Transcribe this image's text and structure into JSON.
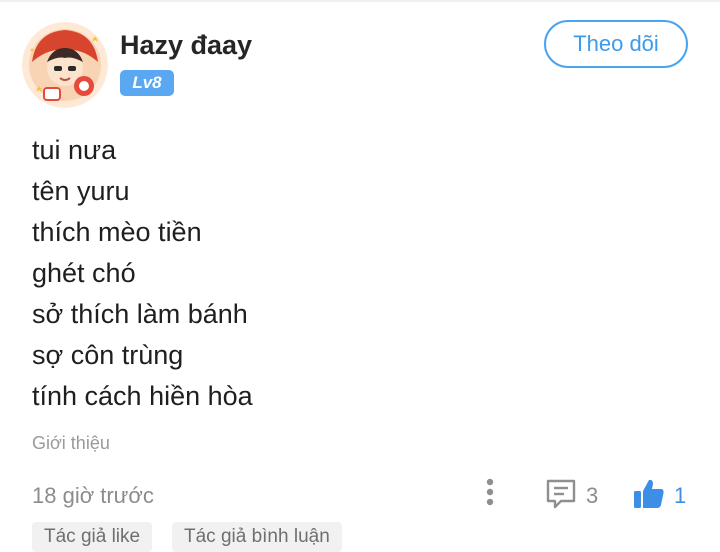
{
  "post": {
    "author": {
      "name": "Hazy đaay",
      "level": "Lv8",
      "follow_label": "Theo dõi"
    },
    "content_lines": [
      "tui nưa",
      "tên yuru",
      "thích mèo tiền",
      "ghét chó",
      "sở thích làm bánh",
      "sợ côn trùng",
      "tính cách hiền hòa"
    ],
    "tag": "Giới thiệu",
    "time": "18 giờ trước",
    "comment_count": "3",
    "like_count": "1",
    "chips": [
      "Tác giả like",
      "Tác giả bình luận"
    ]
  },
  "colors": {
    "accent": "#4aa3f0",
    "badge": "#5aa8f2",
    "muted": "#8c8c8c",
    "chip_bg": "#f1f1f1"
  },
  "icons": [
    "avatar-illustration",
    "more-vertical-icon",
    "comment-icon",
    "thumbs-up-icon"
  ]
}
